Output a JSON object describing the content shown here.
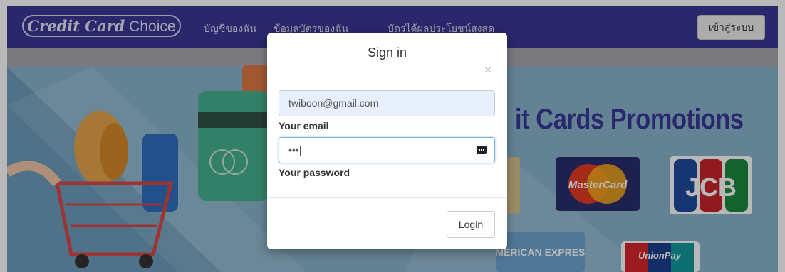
{
  "navbar": {
    "brand_bold": "Credit Card",
    "brand_rest": "Choice",
    "links": [
      "บัญชีของฉัน",
      "ข้อมูลบัตรของฉัน",
      "บัตรได้ผลประโยชน์สูงสุด"
    ],
    "login_label": "เข้าสู่ระบบ"
  },
  "hero": {
    "promo_title": "it Cards Promotions",
    "card_logos": [
      "MasterCard",
      "JCB",
      "AMERICAN EXPRESS",
      "UnionPay"
    ]
  },
  "modal": {
    "title": "Sign in",
    "close_symbol": "×",
    "email_value": "twiboon@gmail.com",
    "email_label": "Your email",
    "password_value": "•••|",
    "password_label": "Your password",
    "submit_label": "Login"
  },
  "colors": {
    "navbar": "#3b3796",
    "hero_background": "#8ab6cf",
    "promo_title": "#3a3898"
  },
  "icons": [
    "password-key-icon",
    "close-icon"
  ]
}
